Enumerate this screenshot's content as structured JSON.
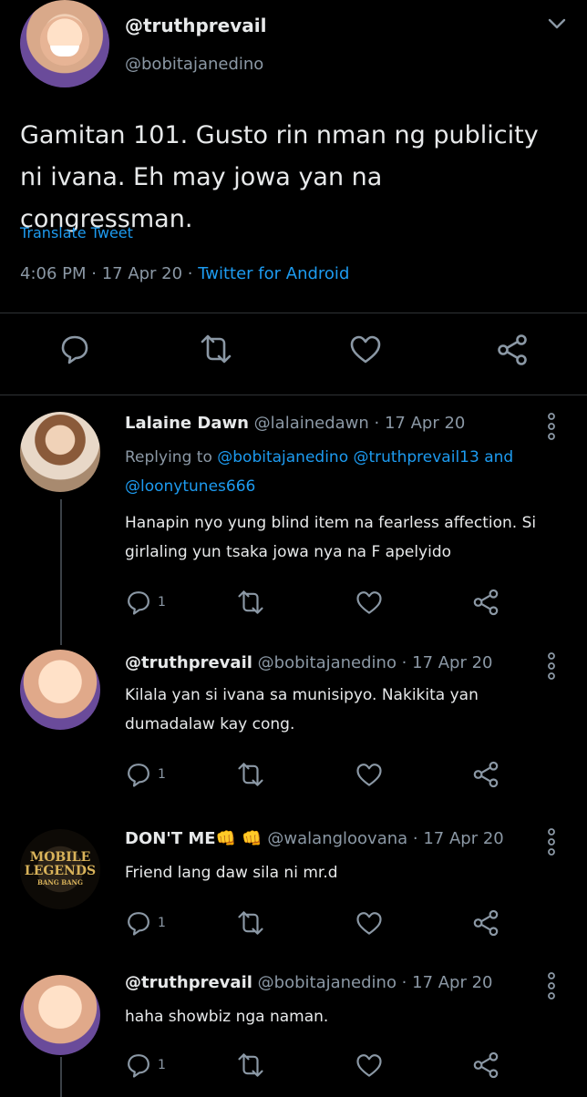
{
  "colors": {
    "background": "#000000",
    "text": "#e7e9ea",
    "muted": "#8b98a5",
    "link": "#1d9bf0",
    "divider": "#2f3336"
  },
  "main_tweet": {
    "name": "@truthprevail",
    "handle": "@bobitajanedino",
    "text": "Gamitan 101. Gusto rin nman ng publicity ni ivana. Eh may jowa yan na congressman.",
    "translate_label": "Translate Tweet",
    "time": "4:06 PM · 17 Apr 20 · ",
    "source": "Twitter for Android",
    "icons": [
      "reply-icon",
      "retweet-icon",
      "like-icon",
      "share-icon"
    ]
  },
  "replies": [
    {
      "name": "Lalaine Dawn",
      "handle_date": "@lalainedawn · 17 Apr 20",
      "replying_prefix": "Replying to ",
      "replying_to": "@bobitajanedino @truthprevail13 and @loonytunes666",
      "text": "Hanapin nyo yung blind item na fearless affection. Si girlaling yun tsaka jowa nya na F apelyido",
      "reply_count": "1"
    },
    {
      "name": "@truthprevail",
      "handle_date": "@bobitajanedino · 17 Apr 20",
      "text": "Kilala yan si ivana sa munisipyo. Nakikita yan dumadalaw kay cong.",
      "reply_count": "1"
    },
    {
      "name": "DON'T ME👊 👊",
      "handle_date": "@walangloovana · 17 Apr 20",
      "text": "Friend lang daw sila ni mr.d",
      "reply_count": "1",
      "avatar_text_line1": "MOBILE",
      "avatar_text_line2": "LEGENDS",
      "avatar_text_line3": "BANG BANG"
    },
    {
      "name": "@truthprevail",
      "handle_date": "@bobitajanedino · 17 Apr 20",
      "text": "haha showbiz nga naman.",
      "reply_count": "1"
    }
  ]
}
